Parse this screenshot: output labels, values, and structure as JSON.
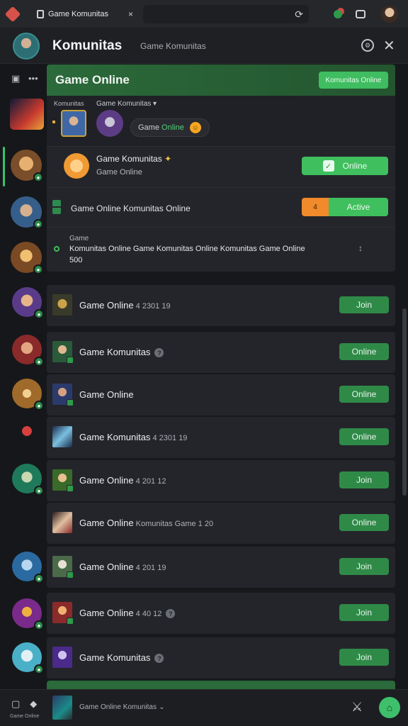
{
  "browser": {
    "tab_title": "Game Komunitas",
    "tab_close": "×",
    "reload_icon": "puzzle-icon"
  },
  "header": {
    "title": "Komunitas",
    "subtitle": "Game Komunitas",
    "settings_icon": "gear-icon",
    "close_label": "✕"
  },
  "panel": {
    "title": "Game Online",
    "cta_label": "Komunitas Online",
    "strip_left_label": "Komunitas",
    "strip_right_label": "Game Komunitas ▾",
    "pill_prefix": "Game ",
    "pill_status": "Online",
    "pill_emoji": "☺",
    "featured": {
      "line1": "Game Komunitas",
      "spark": "✦",
      "line2": "Game Online",
      "button_label": "Online",
      "check": "✓"
    },
    "status_row": {
      "text": "Game Online Komunitas Online",
      "split_left": "4",
      "split_right": "Active"
    },
    "message_row": {
      "heading": "Game",
      "line1": "Komunitas Online Game Komunitas Online Komunitas Game Online",
      "line2": "500",
      "arrows": "↕"
    }
  },
  "list": [
    {
      "name": "Game Online",
      "meta": " 4 2301 19",
      "button": "Join",
      "help": false
    },
    {
      "name": "Game Komunitas",
      "meta": "",
      "button": "Online",
      "help": true
    },
    {
      "name": "Game Online",
      "meta": "",
      "button": "Online",
      "help": false
    },
    {
      "name": "Game Komunitas",
      "meta": " 4 2301 19",
      "button": "Online",
      "help": false
    },
    {
      "name": "Game Online",
      "meta": " 4 201 12",
      "button": "Join",
      "help": false
    },
    {
      "name": "Game Online",
      "meta": " Komunitas Game 1 20",
      "button": "Online",
      "help": false
    },
    {
      "name": "Game Online",
      "meta": " 4 201 19",
      "button": "Join",
      "help": false
    },
    {
      "name": "Game Online",
      "meta": " 4 40 12",
      "button": "Join",
      "help": true
    },
    {
      "name": "Game Komunitas",
      "meta": "",
      "button": "Join",
      "help": true
    }
  ],
  "footer": {
    "caption": "Game Online",
    "title": "Game Online",
    "title_meta": " Komunitas",
    "chevron": "⌄",
    "fab_label": "⌂"
  }
}
